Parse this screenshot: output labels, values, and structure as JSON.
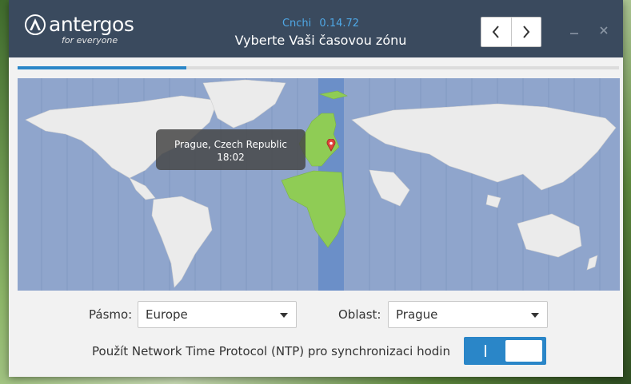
{
  "header": {
    "logo_word": "antergos",
    "logo_tagline": "for everyone",
    "app_name": "Cnchi",
    "app_version": "0.14.72",
    "page_title": "Vyberte Vaši časovou zónu",
    "back_icon": "chevron-left-icon",
    "forward_icon": "chevron-right-icon",
    "minimize_icon": "minimize-icon",
    "close_icon": "close-icon"
  },
  "progress": {
    "fraction": 0.28
  },
  "map": {
    "selected_location": "Prague, Czech Republic",
    "selected_time": "18:02",
    "highlight_color": "#8fcc55",
    "selected_band_color": "#6b8fc8",
    "pin_icon": "location-pin-icon"
  },
  "form": {
    "zone_label": "Pásmo:",
    "zone_value": "Europe",
    "region_label": "Oblast:",
    "region_value": "Prague",
    "ntp_label": "Použít Network Time Protocol (NTP) pro synchronizaci hodin",
    "ntp_enabled": true
  },
  "colors": {
    "titlebar": "#3a4a5e",
    "accent": "#2a86c8",
    "version_text": "#4fa8e6",
    "ocean": "#8fa5cc",
    "land": "#ebebeb"
  }
}
